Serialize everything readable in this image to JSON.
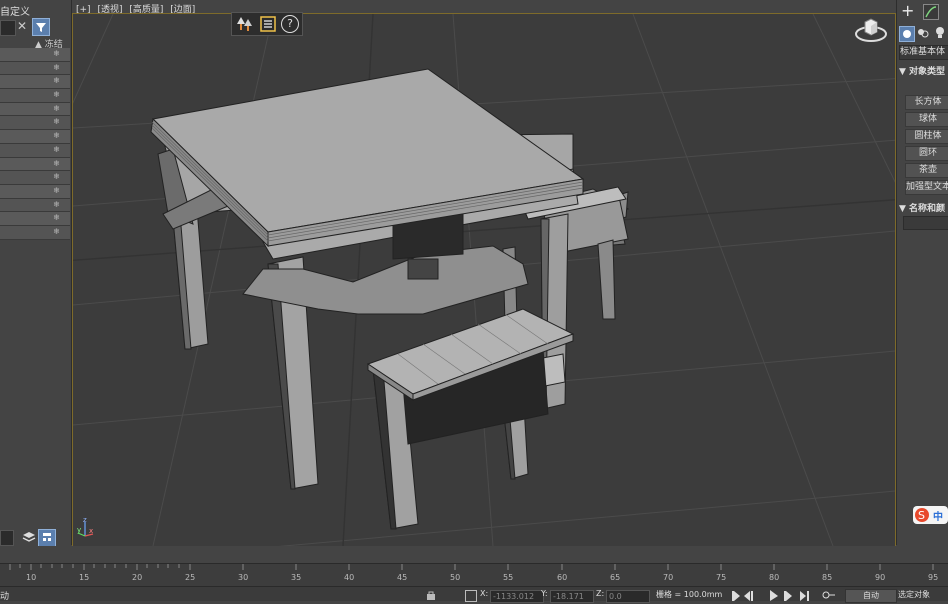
{
  "scene_explorer": {
    "header": "自定义",
    "clear_icon": "✕",
    "column_freeze": "▲ 冻结",
    "freeze_icon": "❄",
    "row_count": 15
  },
  "viewport": {
    "label_parts": [
      "[+]",
      "[透视]",
      "[高质量]",
      "[边面]"
    ],
    "axis_z": "z",
    "axis_x": "x",
    "axis_y": "y"
  },
  "viewport_toolbar": {
    "tree_icon": "scene-tree-icon",
    "list_icon": "list-icon",
    "help_icon": "?"
  },
  "command_panel": {
    "plus": "+",
    "category_label": "标准基本体",
    "section_object_type": "▼ 对象类型",
    "buttons": [
      "长方体",
      "球体",
      "圆柱体",
      "圆环",
      "茶壶",
      "加强型文本"
    ],
    "section_name_color": "▼ 名称和颜"
  },
  "timeline": {
    "ticks": [
      "10",
      "15",
      "20",
      "25",
      "30",
      "35",
      "40",
      "45",
      "50",
      "55",
      "60",
      "65",
      "70",
      "75",
      "80",
      "85",
      "90",
      "95"
    ]
  },
  "status": {
    "left_text": "动",
    "x_label": "X:",
    "x_value": "-1133.012",
    "y_label": "Y:",
    "y_value": "-18.171",
    "z_label": "Z:",
    "z_value": "0.0",
    "grid_label": "栅格 = 100.0mm",
    "auto_key": "自动",
    "selected": "选定对象"
  },
  "ime": {
    "label": "中"
  }
}
